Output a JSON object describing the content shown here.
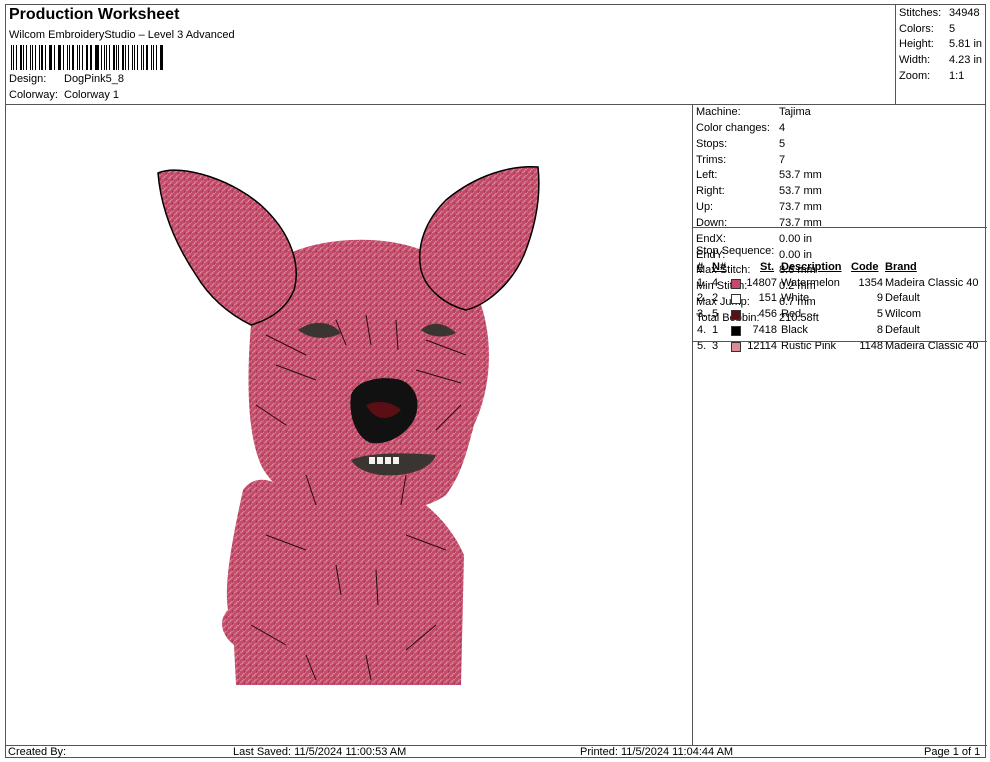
{
  "header": {
    "title": "Production Worksheet",
    "subtitle": "Wilcom EmbroideryStudio – Level 3 Advanced",
    "design_label": "Design:",
    "design_value": "DogPink5_8",
    "colorway_label": "Colorway:",
    "colorway_value": "Colorway 1"
  },
  "summary": [
    {
      "label": "Stitches:",
      "value": "34948"
    },
    {
      "label": "Colors:",
      "value": "5"
    },
    {
      "label": "Height:",
      "value": "5.81 in"
    },
    {
      "label": "Width:",
      "value": "4.23 in"
    },
    {
      "label": "Zoom:",
      "value": "1:1"
    }
  ],
  "machine_info": [
    {
      "label": "Machine:",
      "value": "Tajima"
    },
    {
      "label": "Color changes:",
      "value": "4"
    },
    {
      "label": "Stops:",
      "value": "5"
    },
    {
      "label": "Trims:",
      "value": "7"
    },
    {
      "label": "Left:",
      "value": "53.7 mm"
    },
    {
      "label": "Right:",
      "value": "53.7 mm"
    },
    {
      "label": "Up:",
      "value": "73.7 mm"
    },
    {
      "label": "Down:",
      "value": "73.7 mm"
    },
    {
      "label": "EndX:",
      "value": "0.00 in"
    },
    {
      "label": "EndY:",
      "value": "0.00 in"
    },
    {
      "label": "Max Stitch:",
      "value": "8.6 mm"
    },
    {
      "label": "Min Stitch:",
      "value": "0.2 mm"
    },
    {
      "label": "Max Jump:",
      "value": "6.7 mm"
    },
    {
      "label": "Total Bobbin:",
      "value": "210.58ft"
    }
  ],
  "stop_sequence": {
    "title": "Stop Sequence:",
    "headers": {
      "num": "#",
      "n": "N#",
      "st": "St.",
      "desc": "Description",
      "code": "Code",
      "brand": "Brand"
    },
    "rows": [
      {
        "num": "1.",
        "n": "4",
        "color": "#c5496b",
        "st": "14807",
        "desc": "Watermelon",
        "code": "1354",
        "brand": "Madeira Classic 40"
      },
      {
        "num": "2.",
        "n": "2",
        "color": "#ffffff",
        "st": "151",
        "desc": "White",
        "code": "9",
        "brand": "Default"
      },
      {
        "num": "3.",
        "n": "5",
        "color": "#5a0f14",
        "st": "456",
        "desc": "Red",
        "code": "5",
        "brand": "Wilcom"
      },
      {
        "num": "4.",
        "n": "1",
        "color": "#000000",
        "st": "7418",
        "desc": "Black",
        "code": "8",
        "brand": "Default"
      },
      {
        "num": "5.",
        "n": "3",
        "color": "#dc8c98",
        "st": "12114",
        "desc": "Rustic Pink",
        "code": "1148",
        "brand": "Madeira Classic 40"
      }
    ]
  },
  "footer": {
    "created_by": "Created By:",
    "last_saved": "Last Saved: 11/5/2024 11:00:53 AM",
    "printed": "Printed: 11/5/2024 11:04:44 AM",
    "page": "Page 1 of 1"
  },
  "colors": {
    "fur_main": "#c5496b",
    "fur_light": "#dc8c98",
    "outline": "#000000",
    "mouth": "#5a0f14"
  }
}
